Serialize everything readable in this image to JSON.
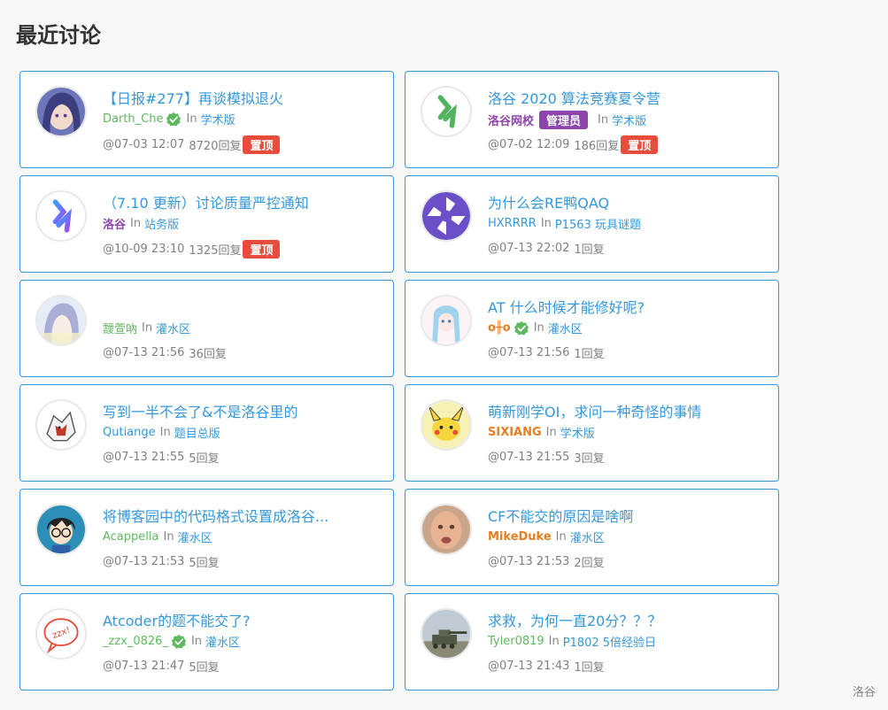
{
  "page": {
    "title": "最近讨论",
    "brand": "洛谷"
  },
  "colors": {
    "accent": "#3498db",
    "green": "#5eb95e",
    "purple": "#8e44ad",
    "orange": "#e67e22",
    "red": "#e74c3c"
  },
  "discussions": [
    {
      "title": "【日报#277】再谈模拟退火",
      "user": "Darth_Che",
      "user_color": "#5eb95e",
      "user_bold": false,
      "verified": true,
      "admin_badge": "",
      "in": "In",
      "forum": "学术版",
      "time": "@07-03 12:07",
      "replies": "8720回复",
      "pinned": "置顶",
      "avatar": "purple-hair-avatar"
    },
    {
      "title": "洛谷 2020 算法竞赛夏令营",
      "user": "洛谷网校",
      "user_color": "#8e44ad",
      "user_bold": true,
      "verified": false,
      "admin_badge": "管理员",
      "in": "In",
      "forum": "学术版",
      "time": "@07-02 12:09",
      "replies": "186回复",
      "pinned": "置顶",
      "avatar": "luogu-green-logo"
    },
    {
      "title": "（7.10 更新）讨论质量严控通知",
      "user": "洛谷",
      "user_color": "#8e44ad",
      "user_bold": true,
      "verified": false,
      "admin_badge": "",
      "in": "In",
      "forum": "站务版",
      "time": "@10-09 23:10",
      "replies": "1325回复",
      "pinned": "置顶",
      "avatar": "luogu-blue-logo"
    },
    {
      "title": "为什么会RE鸭QAQ",
      "user": "HXRRRR",
      "user_color": "#3498db",
      "user_bold": false,
      "verified": false,
      "admin_badge": "",
      "in": "In",
      "forum": "P1563 玩具谜题",
      "time": "@07-13 22:02",
      "replies": "1回复",
      "pinned": "",
      "avatar": "purple-pinwheel"
    },
    {
      "title": "",
      "user": "靉萱吶",
      "user_color": "#5eb95e",
      "user_bold": false,
      "verified": false,
      "admin_badge": "",
      "in": "In",
      "forum": "灌水区",
      "time": "@07-13 21:56",
      "replies": "36回复",
      "pinned": "",
      "avatar": "anime-girl-pale"
    },
    {
      "title": "AT 什么时候才能修好呢?",
      "user": "o╫o",
      "user_color": "#e67e22",
      "user_bold": true,
      "verified": true,
      "admin_badge": "",
      "in": "In",
      "forum": "灌水区",
      "time": "@07-13 21:56",
      "replies": "1回复",
      "pinned": "",
      "avatar": "anime-girl-blue-hair"
    },
    {
      "title": "写到一半不会了&不是洛谷里的",
      "user": "Qutiange",
      "user_color": "#3498db",
      "user_bold": false,
      "verified": false,
      "admin_badge": "",
      "in": "In",
      "forum": "题目总版",
      "time": "@07-13 21:55",
      "replies": "5回复",
      "pinned": "",
      "avatar": "wolf-creature"
    },
    {
      "title": "萌新刚学OI，求问一种奇怪的事情",
      "user": "SIXIANG",
      "user_color": "#e67e22",
      "user_bold": true,
      "verified": false,
      "admin_badge": "",
      "in": "In",
      "forum": "学术版",
      "time": "@07-13 21:55",
      "replies": "3回复",
      "pinned": "",
      "avatar": "yellow-pokemon"
    },
    {
      "title": "将博客园中的代码格式设置成洛谷...",
      "user": "Acappella",
      "user_color": "#5eb95e",
      "user_bold": false,
      "verified": false,
      "admin_badge": "",
      "in": "In",
      "forum": "灌水区",
      "time": "@07-13 21:53",
      "replies": "5回复",
      "pinned": "",
      "avatar": "detective-boy"
    },
    {
      "title": "CF不能交的原因是啥啊",
      "user": "MikeDuke",
      "user_color": "#e67e22",
      "user_bold": true,
      "verified": false,
      "admin_badge": "",
      "in": "In",
      "forum": "灌水区",
      "time": "@07-13 21:53",
      "replies": "2回复",
      "pinned": "",
      "avatar": "face-photo"
    },
    {
      "title": "Atcoder的题不能交了?",
      "user": "_zzx_0826_",
      "user_color": "#5eb95e",
      "user_bold": false,
      "verified": true,
      "admin_badge": "",
      "in": "In",
      "forum": "灌水区",
      "time": "@07-13 21:47",
      "replies": "5回复",
      "pinned": "",
      "avatar": "zzx-speech-bubble"
    },
    {
      "title": "求救，为何一直20分？？？",
      "user": "Tyler0819",
      "user_color": "#5eb95e",
      "user_bold": false,
      "verified": false,
      "admin_badge": "",
      "in": "In",
      "forum": "P1802 5倍经验日",
      "time": "@07-13 21:43",
      "replies": "1回复",
      "pinned": "",
      "avatar": "tank-photo"
    }
  ]
}
